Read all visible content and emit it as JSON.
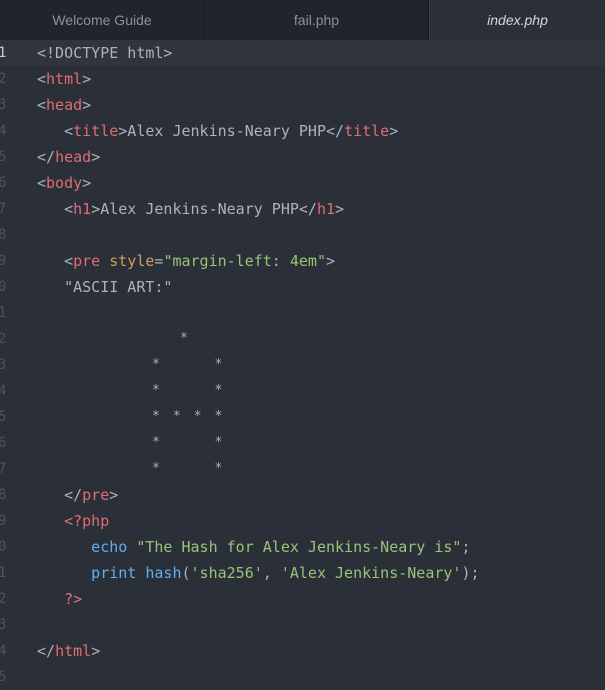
{
  "tabs": [
    {
      "label": "Welcome Guide"
    },
    {
      "label": "fail.php"
    },
    {
      "label": "index.php"
    }
  ],
  "lines": [
    {
      "n": "1",
      "segs": [
        [
          "pt",
          "<!DOCTYPE html>"
        ]
      ]
    },
    {
      "n": "2",
      "segs": [
        [
          "pt",
          "<"
        ],
        [
          "tag",
          "html"
        ],
        [
          "pt",
          ">"
        ]
      ]
    },
    {
      "n": "3",
      "segs": [
        [
          "pt",
          "<"
        ],
        [
          "tag",
          "head"
        ],
        [
          "pt",
          ">"
        ]
      ]
    },
    {
      "n": "4",
      "segs": [
        [
          "pt",
          "   <"
        ],
        [
          "tag",
          "title"
        ],
        [
          "pt",
          ">Alex Jenkins-Neary PHP</"
        ],
        [
          "tag",
          "title"
        ],
        [
          "pt",
          ">"
        ]
      ]
    },
    {
      "n": "5",
      "segs": [
        [
          "pt",
          "</"
        ],
        [
          "tag",
          "head"
        ],
        [
          "pt",
          ">"
        ]
      ]
    },
    {
      "n": "6",
      "segs": [
        [
          "pt",
          "<"
        ],
        [
          "tag",
          "body"
        ],
        [
          "pt",
          ">"
        ]
      ]
    },
    {
      "n": "7",
      "segs": [
        [
          "pt",
          "   <"
        ],
        [
          "tag",
          "h1"
        ],
        [
          "pt",
          ">Alex Jenkins-Neary PHP</"
        ],
        [
          "tag",
          "h1"
        ],
        [
          "pt",
          ">"
        ]
      ]
    },
    {
      "n": "8",
      "segs": []
    },
    {
      "n": "9",
      "segs": [
        [
          "pt",
          "   <"
        ],
        [
          "tag",
          "pre"
        ],
        [
          "pt",
          " "
        ],
        [
          "attr",
          "style"
        ],
        [
          "pt",
          "="
        ],
        [
          "str",
          "\"margin-left: 4em\""
        ],
        [
          "pt",
          ">"
        ]
      ]
    },
    {
      "n": "0",
      "segs": [
        [
          "pt",
          "   \"ASCII ART:\""
        ]
      ]
    },
    {
      "n": "1",
      "segs": []
    },
    {
      "n": "2",
      "segs": [
        [
          "star",
          "*"
        ]
      ]
    },
    {
      "n": "3",
      "segs": [
        [
          "star",
          "*     *"
        ]
      ]
    },
    {
      "n": "4",
      "segs": [
        [
          "star",
          "*     *"
        ]
      ]
    },
    {
      "n": "5",
      "segs": [
        [
          "star",
          "* * * *"
        ]
      ]
    },
    {
      "n": "6",
      "segs": [
        [
          "star",
          "*     *"
        ]
      ]
    },
    {
      "n": "7",
      "segs": [
        [
          "star",
          "*     *"
        ]
      ]
    },
    {
      "n": "8",
      "segs": [
        [
          "pt",
          "   </"
        ],
        [
          "tag",
          "pre"
        ],
        [
          "pt",
          ">"
        ]
      ]
    },
    {
      "n": "9",
      "segs": [
        [
          "php",
          "   <?php"
        ]
      ]
    },
    {
      "n": "0",
      "segs": [
        [
          "kw",
          "      echo "
        ],
        [
          "str",
          "\"The Hash for Alex Jenkins-Neary is\""
        ],
        [
          "pt",
          ";"
        ]
      ]
    },
    {
      "n": "1",
      "segs": [
        [
          "kw",
          "      print "
        ],
        [
          "kw",
          "hash"
        ],
        [
          "pt",
          "("
        ],
        [
          "str",
          "'sha256'"
        ],
        [
          "pt",
          ", "
        ],
        [
          "str",
          "'Alex Jenkins-Neary'"
        ],
        [
          "pt",
          ");"
        ]
      ]
    },
    {
      "n": "2",
      "segs": [
        [
          "php",
          "   ?>"
        ]
      ]
    },
    {
      "n": "3",
      "segs": []
    },
    {
      "n": "4",
      "segs": [
        [
          "pt",
          "</"
        ],
        [
          "tag",
          "html"
        ],
        [
          "pt",
          ">"
        ]
      ]
    },
    {
      "n": "5",
      "segs": []
    }
  ],
  "colors": {
    "background": "#2b3038",
    "tag": "#e06c75",
    "string": "#98c379",
    "attribute": "#d19a66",
    "keyword": "#61afef"
  }
}
